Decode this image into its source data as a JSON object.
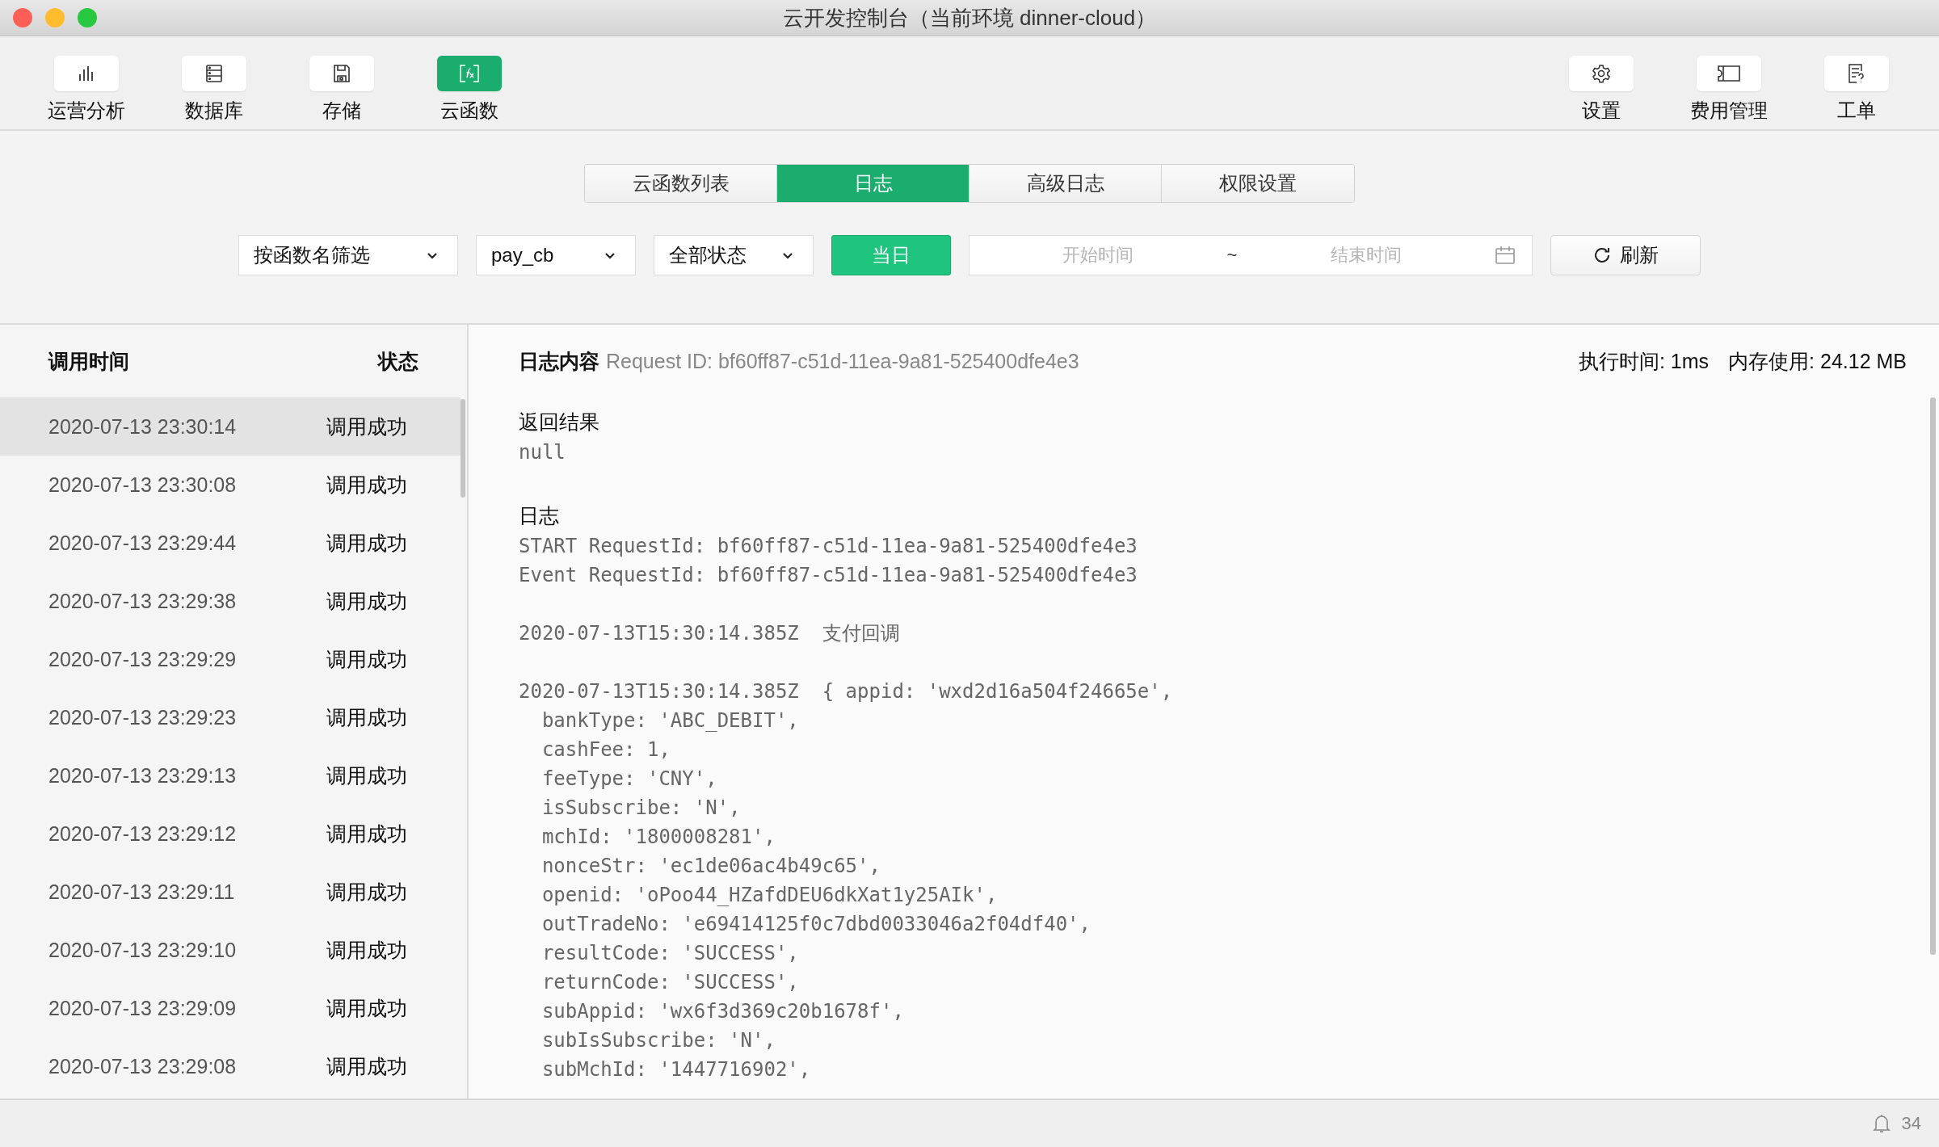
{
  "window": {
    "title": "云开发控制台（当前环境 dinner-cloud）"
  },
  "toolbar": {
    "left": [
      {
        "label": "运营分析",
        "kind": "chart",
        "selected": false
      },
      {
        "label": "数据库",
        "kind": "database",
        "selected": false
      },
      {
        "label": "存储",
        "kind": "storage",
        "selected": false
      },
      {
        "label": "云函数",
        "kind": "function",
        "selected": true
      }
    ],
    "right": [
      {
        "label": "设置",
        "kind": "settings",
        "selected": false
      },
      {
        "label": "费用管理",
        "kind": "billing",
        "selected": false
      },
      {
        "label": "工单",
        "kind": "ticket",
        "selected": false
      }
    ]
  },
  "tabs": [
    {
      "label": "云函数列表",
      "selected": false
    },
    {
      "label": "日志",
      "selected": true
    },
    {
      "label": "高级日志",
      "selected": false
    },
    {
      "label": "权限设置",
      "selected": false
    }
  ],
  "filters": {
    "function_filter": "按函数名筛选",
    "function_name": "pay_cb",
    "status": "全部状态",
    "today_button": "当日",
    "start_placeholder": "开始时间",
    "separator": "~",
    "end_placeholder": "结束时间",
    "refresh_button": "刷新"
  },
  "list": {
    "columns": [
      "调用时间",
      "状态"
    ],
    "rows": [
      {
        "time": "2020-07-13 23:30:14",
        "status": "调用成功",
        "selected": true
      },
      {
        "time": "2020-07-13 23:30:08",
        "status": "调用成功",
        "selected": false
      },
      {
        "time": "2020-07-13 23:29:44",
        "status": "调用成功",
        "selected": false
      },
      {
        "time": "2020-07-13 23:29:38",
        "status": "调用成功",
        "selected": false
      },
      {
        "time": "2020-07-13 23:29:29",
        "status": "调用成功",
        "selected": false
      },
      {
        "time": "2020-07-13 23:29:23",
        "status": "调用成功",
        "selected": false
      },
      {
        "time": "2020-07-13 23:29:13",
        "status": "调用成功",
        "selected": false
      },
      {
        "time": "2020-07-13 23:29:12",
        "status": "调用成功",
        "selected": false
      },
      {
        "time": "2020-07-13 23:29:11",
        "status": "调用成功",
        "selected": false
      },
      {
        "time": "2020-07-13 23:29:10",
        "status": "调用成功",
        "selected": false
      },
      {
        "time": "2020-07-13 23:29:09",
        "status": "调用成功",
        "selected": false
      },
      {
        "time": "2020-07-13 23:29:08",
        "status": "调用成功",
        "selected": false
      }
    ]
  },
  "detail": {
    "title": "日志内容",
    "request_id": "Request ID: bf60ff87-c51d-11ea-9a81-525400dfe4e3",
    "exec_time": "执行时间: 1ms",
    "memory": "内存使用: 24.12 MB",
    "result_heading": "返回结果",
    "result": "null",
    "log_heading": "日志",
    "log_groups": [
      [
        "START RequestId: bf60ff87-c51d-11ea-9a81-525400dfe4e3",
        "Event RequestId: bf60ff87-c51d-11ea-9a81-525400dfe4e3"
      ],
      [
        "2020-07-13T15:30:14.385Z  支付回调"
      ],
      [
        "2020-07-13T15:30:14.385Z  { appid: 'wxd2d16a504f24665e',",
        "  bankType: 'ABC_DEBIT',",
        "  cashFee: 1,",
        "  feeType: 'CNY',",
        "  isSubscribe: 'N',",
        "  mchId: '1800008281',",
        "  nonceStr: 'ec1de06ac4b49c65',",
        "  openid: 'oPoo44_HZafdDEU6dkXat1y25AIk',",
        "  outTradeNo: 'e69414125f0c7dbd0033046a2f04df40',",
        "  resultCode: 'SUCCESS',",
        "  returnCode: 'SUCCESS',",
        "  subAppid: 'wx6f3d369c20b1678f',",
        "  subIsSubscribe: 'N',",
        "  subMchId: '1447716902',"
      ]
    ]
  },
  "status_bar": {
    "notifications": "34"
  }
}
